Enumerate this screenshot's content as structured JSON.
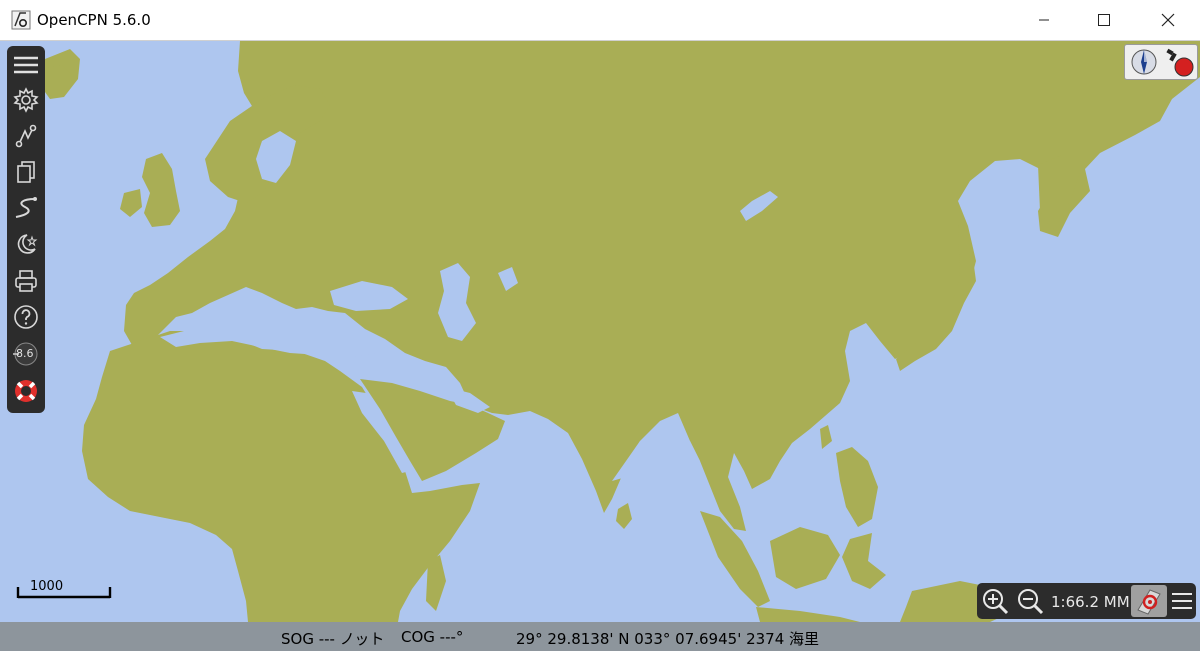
{
  "window": {
    "title": "OpenCPN 5.6.0",
    "controls": {
      "minimize": "minimize",
      "maximize": "maximize",
      "close": "close"
    }
  },
  "colors": {
    "sea": "#aec6ef",
    "land": "#a9ae55",
    "toolbar": "#2c2c2c",
    "status_bar": "#8d959c"
  },
  "toolbar": {
    "items": [
      {
        "name": "menu",
        "icon": "hamburger-icon"
      },
      {
        "name": "settings",
        "icon": "gear-icon"
      },
      {
        "name": "route",
        "icon": "route-icon"
      },
      {
        "name": "route-manager",
        "icon": "pages-icon"
      },
      {
        "name": "track",
        "icon": "track-icon"
      },
      {
        "name": "color-scheme",
        "icon": "moon-star-icon"
      },
      {
        "name": "print",
        "icon": "printer-icon"
      },
      {
        "name": "help",
        "icon": "question-icon"
      },
      {
        "name": "tides",
        "icon": "tide-icon",
        "label": "8.6"
      },
      {
        "name": "mob",
        "icon": "lifebuoy-icon"
      }
    ]
  },
  "map": {
    "scale_bar_label": "1000",
    "compass_icon": "compass-icon",
    "gps_icon": "gps-status-icon"
  },
  "zoom_panel": {
    "zoom_in_icon": "zoom-in-icon",
    "zoom_out_icon": "zoom-out-icon",
    "scale": "1:66.2 MM",
    "chart_icon": "chart-quilt-icon",
    "menu_icon": "hamburger-icon"
  },
  "status": {
    "sog": "SOG --- ノット",
    "cog": "COG ---°",
    "position": "29° 29.8138' N   033° 07.6945' 2374 海里"
  }
}
